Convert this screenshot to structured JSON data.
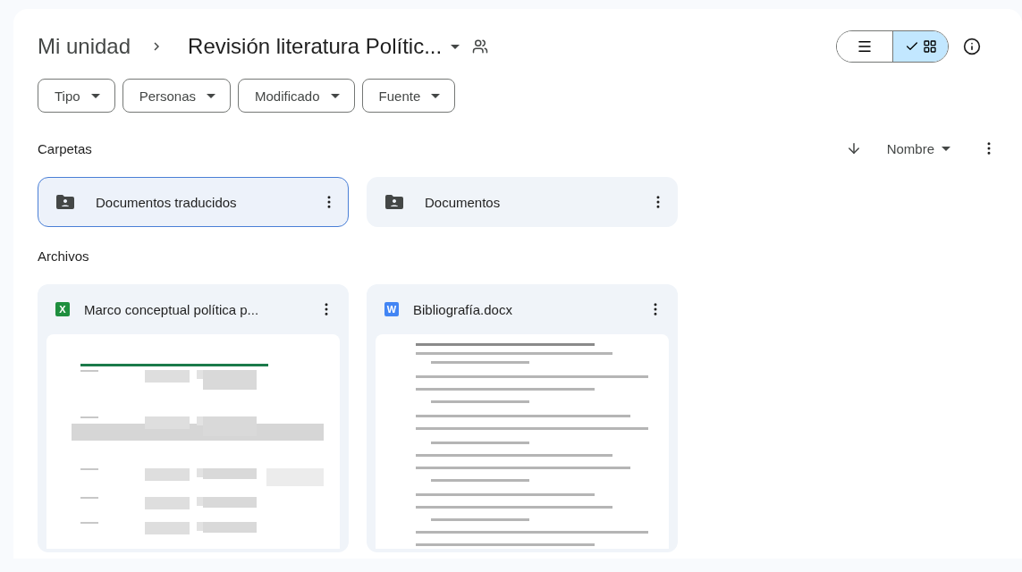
{
  "breadcrumb": {
    "root": "Mi unidad",
    "current": "Revisión literatura Polític..."
  },
  "view_toggle": [
    {
      "kind": "list",
      "selected": false
    },
    {
      "kind": "grid",
      "selected": true
    }
  ],
  "filters": [
    {
      "label": "Tipo"
    },
    {
      "label": "Personas"
    },
    {
      "label": "Modificado"
    },
    {
      "label": "Fuente"
    }
  ],
  "folders_section": {
    "title": "Carpetas",
    "sort": {
      "label": "Nombre"
    }
  },
  "folders": [
    {
      "name": "Documentos traducidos",
      "selected": true
    },
    {
      "name": "Documentos",
      "selected": false
    }
  ],
  "files_section": {
    "title": "Archivos"
  },
  "files": [
    {
      "name": "Marco conceptual política p...",
      "kind": "sheet",
      "icon_letter": "X",
      "color": "#1e8e3e"
    },
    {
      "name": "Bibliografía.docx",
      "kind": "doc",
      "icon_letter": "W",
      "color": "#4285f4"
    }
  ]
}
